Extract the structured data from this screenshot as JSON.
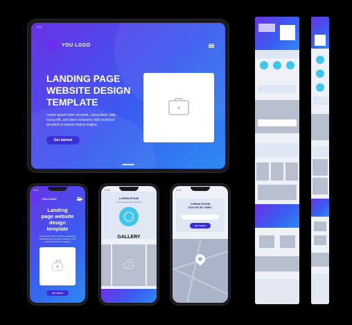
{
  "tablet": {
    "status_time": "9:41",
    "logo_text": "YOU LOGO",
    "headline": [
      "LANDING PAGE",
      "WEBSITE DESIGN",
      "TEMPLATE"
    ],
    "body": [
      "Lorem ipsum dolor sit amet, consectetur adip-",
      "iscing elit, sed diam nonummy nibh euismod",
      "tincidunt ut laoreet dolore magna"
    ],
    "cta": "Get started"
  },
  "phone1": {
    "status_time": "9:41",
    "logo_text": "YOU LOGO",
    "headline": [
      "Landing",
      "page website",
      "design",
      "template"
    ],
    "body": [
      "Lorem ipsum dolor sit amet, consectetur",
      "adipiscing elit, sed diam nonummy nibh",
      "euismod tincidunt ut laoreet"
    ],
    "cta": "Get started"
  },
  "phone2": {
    "status_time": "9:41",
    "title": "LOREM IPSUM",
    "subtitle": "Lorem ipsum dolor sit amet",
    "gallery": "GALLERY"
  },
  "phone3": {
    "status_time": "9:41",
    "title": [
      "LOREM IPSUM",
      "DOLOR SIT AMET"
    ],
    "cta": "Get started"
  },
  "colors": {
    "accent": "#3d2fd8",
    "gradient_start": "#6a32e6",
    "gradient_end": "#2d8bf2",
    "circle": "#6e2cf2",
    "teal": "#3fc6ee",
    "gray": "#b7bfcf"
  },
  "icons": [
    "camera-icon",
    "hamburger-icon",
    "location-pin-icon"
  ]
}
